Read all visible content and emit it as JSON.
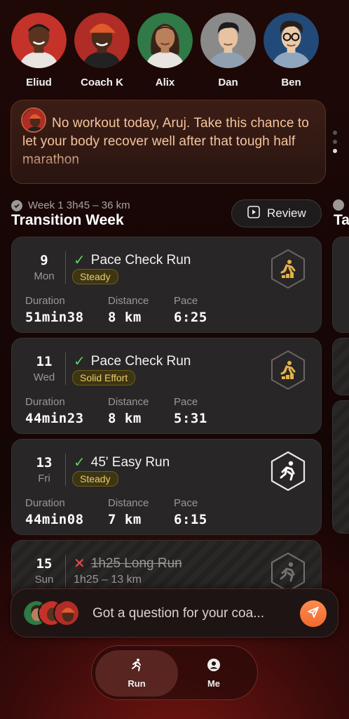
{
  "coaches": [
    {
      "name": "Eliud",
      "bg": "#c4322a",
      "skin": "#5a3320",
      "hair": "#1b1b1b",
      "shirt": "#e9e4df",
      "cap": ""
    },
    {
      "name": "Coach K",
      "bg": "#b02c26",
      "skin": "#4a2a1a",
      "hair": "#1b1b1b",
      "shirt": "#222222",
      "cap": "#e05a2a"
    },
    {
      "name": "Alix",
      "bg": "#2f7a46",
      "skin": "#b9805c",
      "hair": "#3a2218",
      "shirt": "#e8e4df",
      "cap": ""
    },
    {
      "name": "Dan",
      "bg": "#8a8a8a",
      "skin": "#e7c3a2",
      "hair": "#1d1d1d",
      "shirt": "#8ea0b2",
      "cap": ""
    },
    {
      "name": "Ben",
      "bg": "#214a78",
      "skin": "#edc9a9",
      "hair": "#2a1d16",
      "shirt": "#8fa6bf",
      "cap": ""
    }
  ],
  "message": {
    "text": "No workout today, Aruj. Take this chance to let your body recover well after that tough half marathon"
  },
  "week": {
    "meta": "Week 1  3h45 – 36 km",
    "title": "Transition Week",
    "review_label": "Review",
    "next_title": "Ta"
  },
  "workouts": [
    {
      "day": "9",
      "weekday": "Mon",
      "title": "Pace Check Run",
      "badge": "Steady",
      "labels": {
        "duration": "Duration",
        "distance": "Distance",
        "pace": "Pace"
      },
      "duration": "51min38",
      "distance": "8 km",
      "pace": "6:25",
      "icon": "pace-check-icon"
    },
    {
      "day": "11",
      "weekday": "Wed",
      "title": "Pace Check Run",
      "badge": "Solid Effort",
      "labels": {
        "duration": "Duration",
        "distance": "Distance",
        "pace": "Pace"
      },
      "duration": "44min23",
      "distance": "8 km",
      "pace": "5:31",
      "icon": "pace-check-icon"
    },
    {
      "day": "13",
      "weekday": "Fri",
      "title": "45' Easy Run",
      "badge": "Steady",
      "labels": {
        "duration": "Duration",
        "distance": "Distance",
        "pace": "Pace"
      },
      "duration": "44min08",
      "distance": "7 km",
      "pace": "6:15",
      "icon": "running-icon"
    },
    {
      "day": "15",
      "weekday": "Sun",
      "title": "1h25 Long Run",
      "sub": "1h25 – 13 km",
      "icon": "running-icon"
    }
  ],
  "chat": {
    "placeholder": "Got a question for your coa..."
  },
  "tabs": [
    {
      "label": "Run",
      "icon": "run-icon"
    },
    {
      "label": "Me",
      "icon": "profile-icon"
    }
  ]
}
